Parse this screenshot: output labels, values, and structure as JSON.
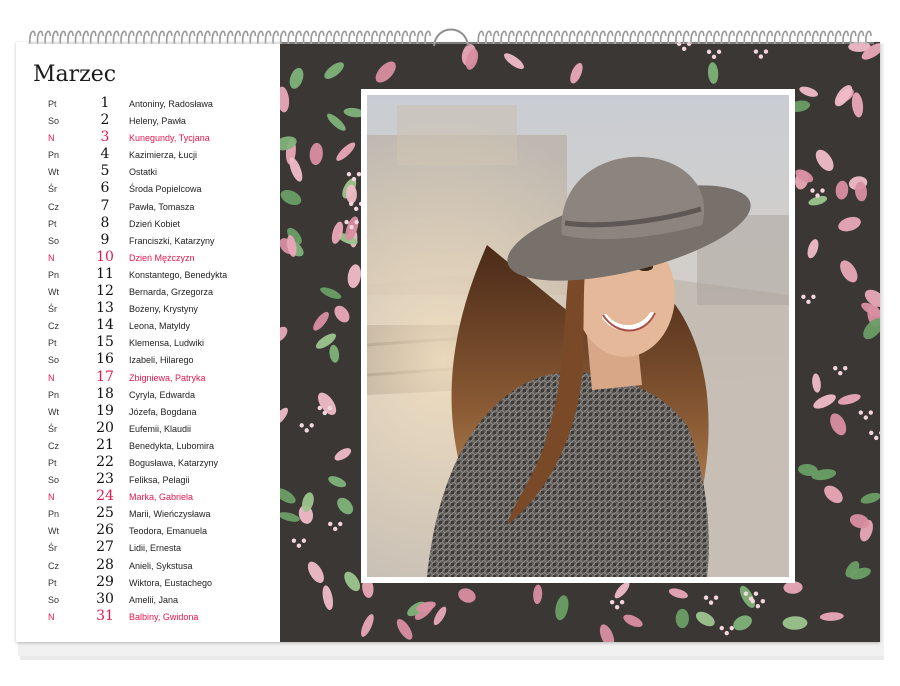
{
  "calendar": {
    "month": "Marzec",
    "colors": {
      "sunday": "#e8174d",
      "text": "#222222",
      "pattern_bg": "#3a3735"
    },
    "days": [
      {
        "weekday": "Pt",
        "day": "1",
        "names": "Antoniny, Radosława",
        "sunday": false
      },
      {
        "weekday": "So",
        "day": "2",
        "names": "Heleny, Pawła",
        "sunday": false
      },
      {
        "weekday": "N",
        "day": "3",
        "names": "Kunegundy, Tycjana",
        "sunday": true
      },
      {
        "weekday": "Pn",
        "day": "4",
        "names": "Kazimierza, Łucji",
        "sunday": false
      },
      {
        "weekday": "Wt",
        "day": "5",
        "names": "Ostatki",
        "sunday": false
      },
      {
        "weekday": "Śr",
        "day": "6",
        "names": "Środa Popielcowa",
        "sunday": false
      },
      {
        "weekday": "Cz",
        "day": "7",
        "names": "Pawła, Tomasza",
        "sunday": false
      },
      {
        "weekday": "Pt",
        "day": "8",
        "names": "Dzień Kobiet",
        "sunday": false
      },
      {
        "weekday": "So",
        "day": "9",
        "names": "Franciszki, Katarzyny",
        "sunday": false
      },
      {
        "weekday": "N",
        "day": "10",
        "names": "Dzień Mężczyzn",
        "sunday": true
      },
      {
        "weekday": "Pn",
        "day": "11",
        "names": "Konstantego, Benedykta",
        "sunday": false
      },
      {
        "weekday": "Wt",
        "day": "12",
        "names": "Bernarda, Grzegorza",
        "sunday": false
      },
      {
        "weekday": "Śr",
        "day": "13",
        "names": "Bożeny, Krystyny",
        "sunday": false
      },
      {
        "weekday": "Cz",
        "day": "14",
        "names": "Leona, Matyldy",
        "sunday": false
      },
      {
        "weekday": "Pt",
        "day": "15",
        "names": "Klemensa, Ludwiki",
        "sunday": false
      },
      {
        "weekday": "So",
        "day": "16",
        "names": "Izabeli, Hilarego",
        "sunday": false
      },
      {
        "weekday": "N",
        "day": "17",
        "names": "Zbigniewa, Patryka",
        "sunday": true
      },
      {
        "weekday": "Pn",
        "day": "18",
        "names": "Cyryla, Edwarda",
        "sunday": false
      },
      {
        "weekday": "Wt",
        "day": "19",
        "names": "Józefa, Bogdana",
        "sunday": false
      },
      {
        "weekday": "Śr",
        "day": "20",
        "names": "Eufemii, Klaudii",
        "sunday": false
      },
      {
        "weekday": "Cz",
        "day": "21",
        "names": "Benedykta, Lubomira",
        "sunday": false
      },
      {
        "weekday": "Pt",
        "day": "22",
        "names": "Bogusława, Katarzyny",
        "sunday": false
      },
      {
        "weekday": "So",
        "day": "23",
        "names": "Feliksa, Pelagii",
        "sunday": false
      },
      {
        "weekday": "N",
        "day": "24",
        "names": "Marka, Gabriela",
        "sunday": true
      },
      {
        "weekday": "Pn",
        "day": "25",
        "names": "Marii, Wieńczysława",
        "sunday": false
      },
      {
        "weekday": "Wt",
        "day": "26",
        "names": "Teodora, Emanuela",
        "sunday": false
      },
      {
        "weekday": "Śr",
        "day": "27",
        "names": "Lidii, Ernesta",
        "sunday": false
      },
      {
        "weekday": "Cz",
        "day": "28",
        "names": "Anieli, Sykstusa",
        "sunday": false
      },
      {
        "weekday": "Pt",
        "day": "29",
        "names": "Wiktora, Eustachego",
        "sunday": false
      },
      {
        "weekday": "So",
        "day": "30",
        "names": "Amelii, Jana",
        "sunday": false
      },
      {
        "weekday": "N",
        "day": "31",
        "names": "Balbiny, Gwidona",
        "sunday": true
      }
    ]
  }
}
